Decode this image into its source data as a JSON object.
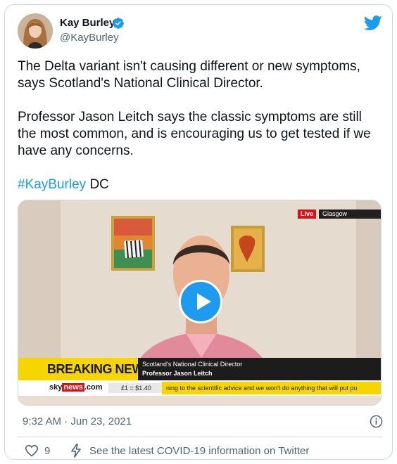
{
  "author": {
    "name": "Kay Burley",
    "handle": "@KayBurley",
    "verified": true,
    "avatar": "avatar-photo"
  },
  "tweet": {
    "paragraph1": "The Delta variant isn't causing different or new symptoms, says Scotland's National Clinical Director.",
    "paragraph2": "Professor Jason Leitch says the classic symptoms are still the most common, and is encouraging us to get tested if we have any concerns.",
    "hashtag": "#KayBurley",
    "signoff": " DC"
  },
  "video": {
    "live_badge": "Live",
    "location": "Glasgow",
    "breaking": "BREAKING NEWS",
    "caption_title": "Scotland's National Clinical Director",
    "caption_name": "Professor Jason Leitch",
    "logo_sky": "sky",
    "logo_news": "news",
    "logo_com": ".com",
    "fx": "£1 = $1.40",
    "ticker": "ning to the scientific advice and we won't do anything that will put pu",
    "play_icon": "play-icon"
  },
  "meta": {
    "timestamp": "9:32 AM · Jun 23, 2021",
    "like_count": "9",
    "covid_link": "See the latest COVID-19 information on Twitter"
  },
  "colors": {
    "accent": "#1d9bf0",
    "text": "#0f1419",
    "muted": "#536471",
    "border": "#cfd9de",
    "breaking_yellow": "#f6d500",
    "sky_red": "#d7141a"
  }
}
